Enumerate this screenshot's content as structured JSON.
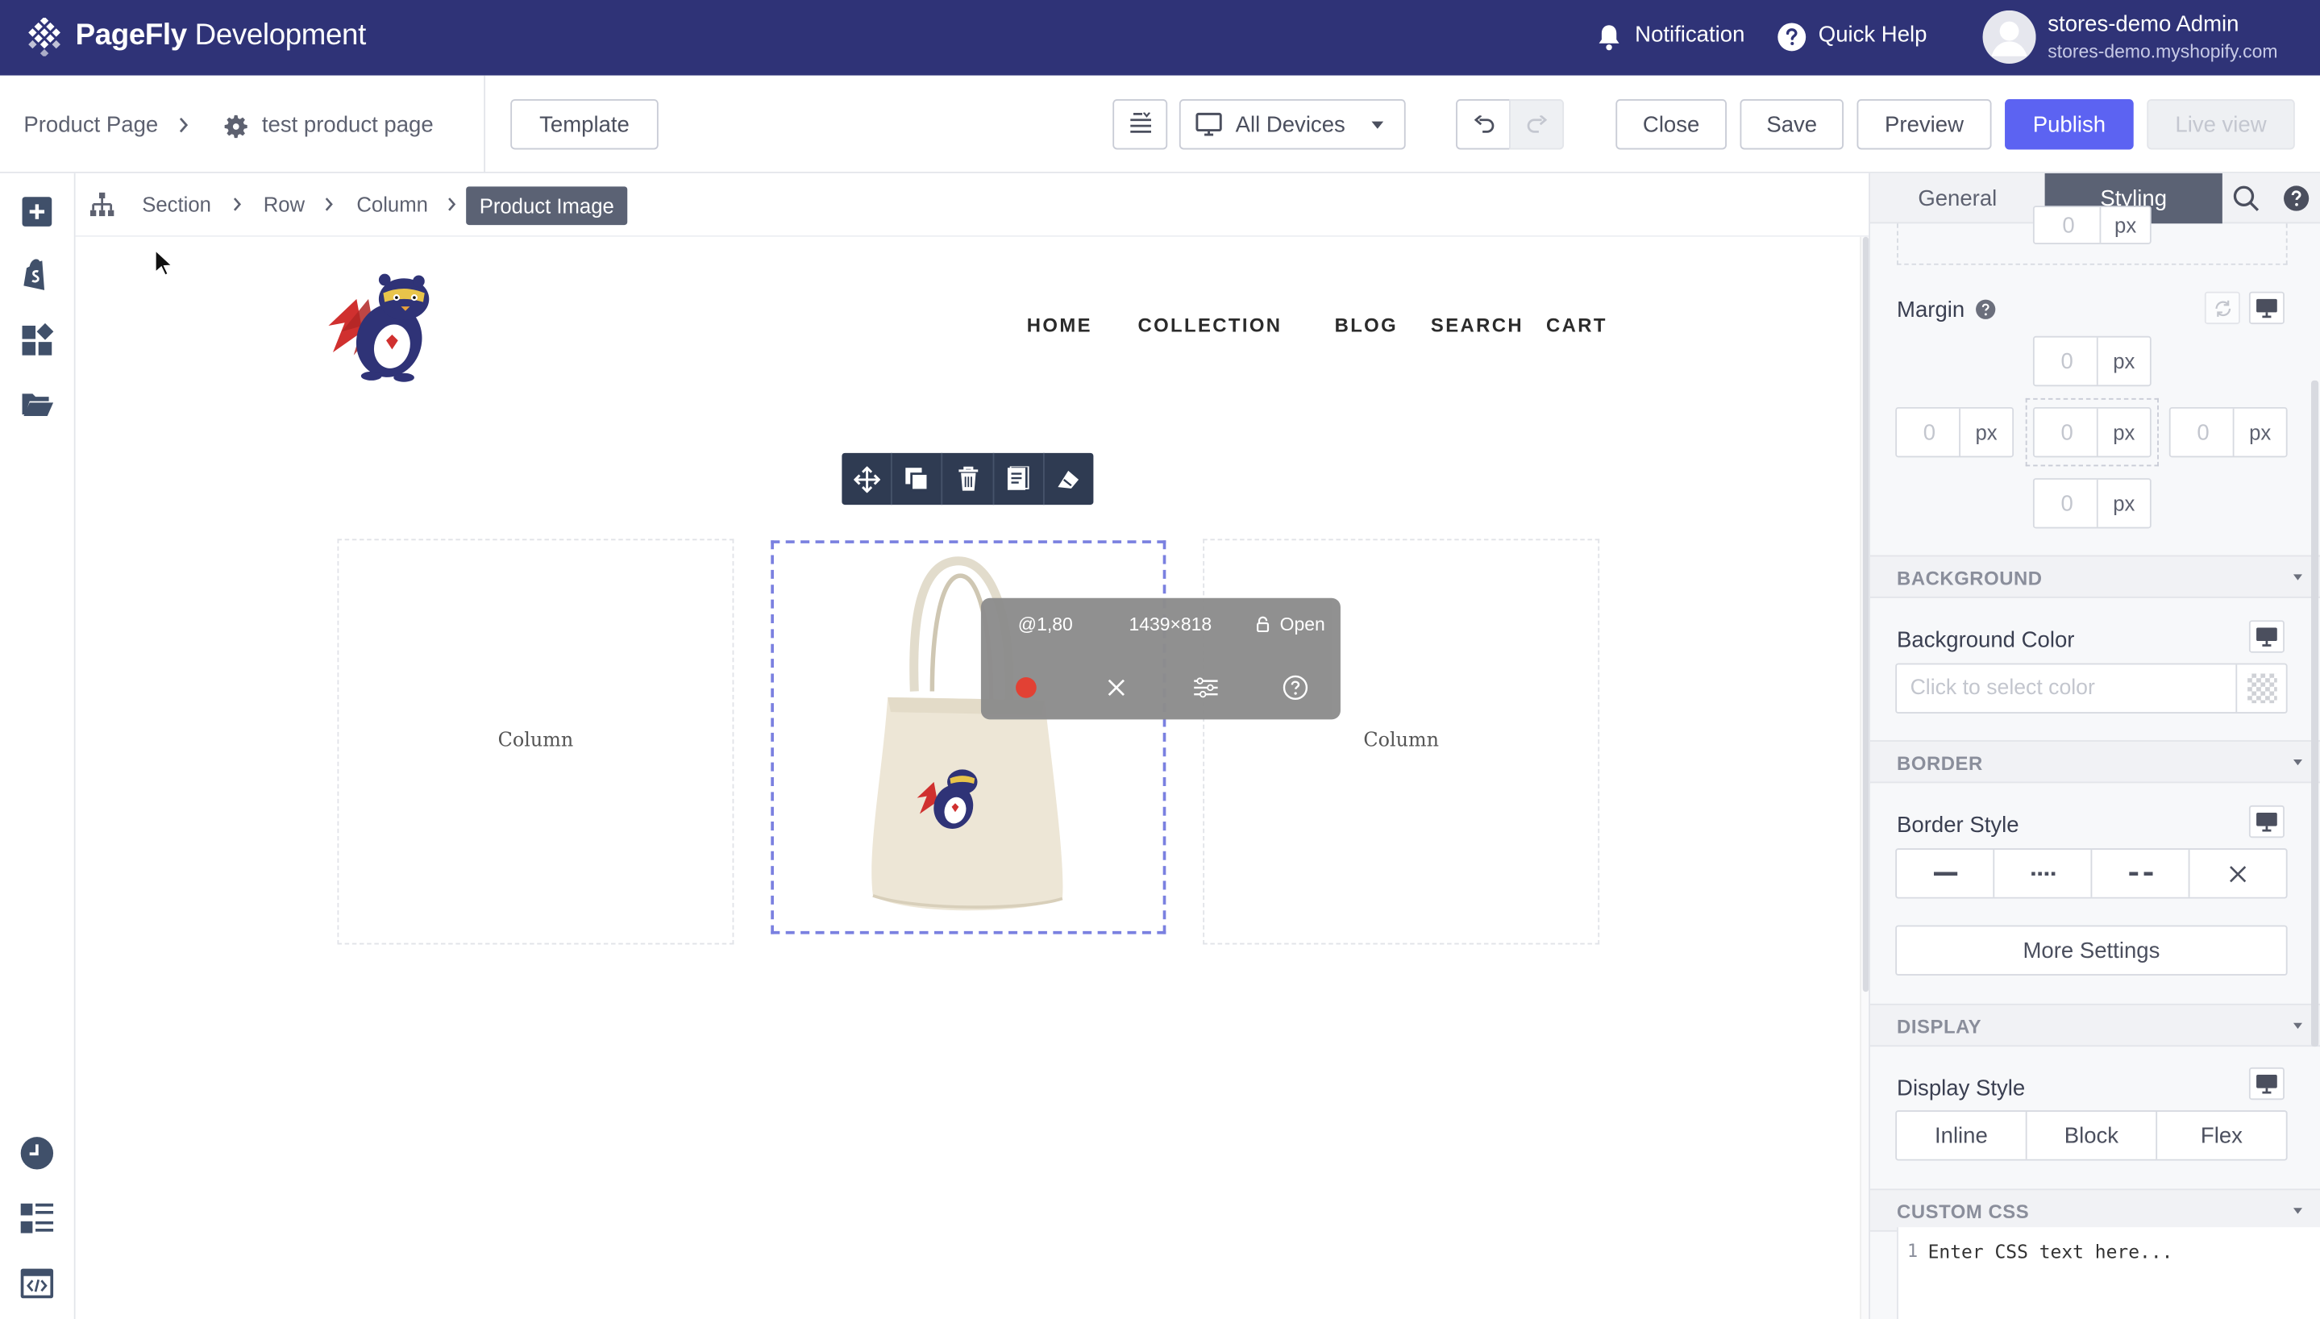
{
  "topbar": {
    "brand_bold": "PageFly",
    "brand_rest": " Development",
    "notification": "Notification",
    "quick_help": "Quick Help",
    "user_name": "stores-demo Admin",
    "user_shop": "stores-demo.myshopify.com"
  },
  "toolbar": {
    "page_type": "Product Page",
    "page_name": "test product page",
    "template": "Template",
    "device": "All Devices",
    "close": "Close",
    "save": "Save",
    "preview": "Preview",
    "publish": "Publish",
    "live_view": "Live view"
  },
  "breadcrumb": {
    "items": [
      "Section",
      "Row",
      "Column"
    ],
    "active": "Product Image"
  },
  "canvas": {
    "nav": [
      "HOME",
      "COLLECTION",
      "BLOG",
      "SEARCH",
      "CART"
    ],
    "column_label": "Column"
  },
  "popup": {
    "coords": "@1,80",
    "size": "1439×818",
    "lock": "Open"
  },
  "panel": {
    "tabs": [
      "General",
      "Styling"
    ],
    "unit": "px",
    "zero": "0",
    "margin": "Margin",
    "background": "BACKGROUND",
    "background_color": "Background Color",
    "color_placeholder": "Click to select color",
    "border": "BORDER",
    "border_style": "Border Style",
    "more_settings": "More Settings",
    "display": "DISPLAY",
    "display_style": "Display Style",
    "display_options": [
      "Inline",
      "Block",
      "Flex"
    ],
    "custom_css": "CUSTOM CSS",
    "css_line": "1",
    "css_placeholder": "Enter CSS text here..."
  },
  "colors": {
    "topbar": "#2f3377",
    "accent": "#5c63f2",
    "selection": "#7a80e0"
  }
}
